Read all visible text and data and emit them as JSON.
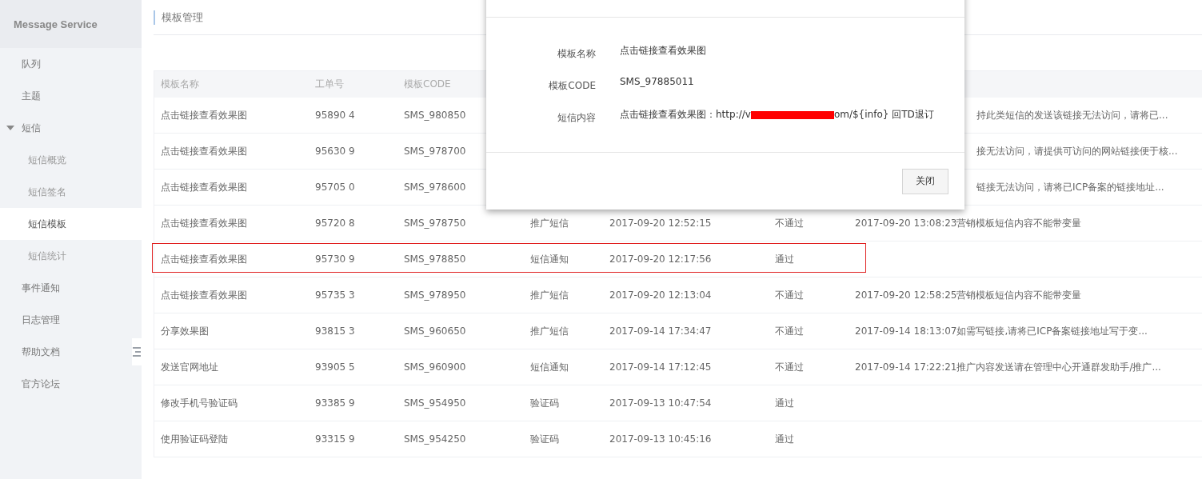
{
  "sidebar": {
    "title": "Message Service",
    "items": [
      {
        "label": "队列",
        "selected": false
      },
      {
        "label": "主题",
        "selected": false
      },
      {
        "label": "短信",
        "selected": false,
        "expanded": true,
        "children": [
          {
            "label": "短信概览",
            "selected": false
          },
          {
            "label": "短信签名",
            "selected": false
          },
          {
            "label": "短信模板",
            "selected": true
          },
          {
            "label": "短信统计",
            "selected": false
          }
        ]
      },
      {
        "label": "事件通知",
        "selected": false
      },
      {
        "label": "日志管理",
        "selected": false
      },
      {
        "label": "帮助文档",
        "selected": false
      },
      {
        "label": "官方论坛",
        "selected": false
      }
    ]
  },
  "page": {
    "title": "模板管理"
  },
  "table": {
    "columns": [
      "模板名称",
      "工单号",
      "模板CODE"
    ],
    "rows": [
      {
        "name": "点击链接查看效果图",
        "ticket": "95890 4",
        "code": "SMS_980850",
        "reason": "持此类短信的发送该链接无法访问，请将已...",
        "partly_hidden": true,
        "highlighted": false
      },
      {
        "name": "点击链接查看效果图",
        "ticket": "95630 9",
        "code": "SMS_978700",
        "reason": "接无法访问，请提供可访问的网站链接便于核...",
        "partly_hidden": true,
        "highlighted": false
      },
      {
        "name": "点击链接查看效果图",
        "ticket": "95705 0",
        "code": "SMS_978600",
        "reason": "链接无法访问，请将已ICP备案的链接地址...",
        "partly_hidden": true,
        "highlighted": false
      },
      {
        "name": "点击链接查看效果图",
        "ticket": "95720 8",
        "code": "SMS_978750",
        "type": "推广短信",
        "time": "2017-09-20 12:52:15",
        "status": "不通过",
        "reason": "2017-09-20 13:08:23营销模板短信内容不能带变量",
        "partly_hidden": false,
        "highlighted": false
      },
      {
        "name": "点击链接查看效果图",
        "ticket": "95730 9",
        "code": "SMS_978850",
        "type": "短信通知",
        "time": "2017-09-20 12:17:56",
        "status": "通过",
        "partly_hidden": false,
        "highlighted": true
      },
      {
        "name": "点击链接查看效果图",
        "ticket": "95735 3",
        "code": "SMS_978950",
        "type": "推广短信",
        "time": "2017-09-20 12:13:04",
        "status": "不通过",
        "reason": "2017-09-20 12:58:25营销模板短信内容不能带变量",
        "partly_hidden": false,
        "highlighted": false
      },
      {
        "name": "分享效果图",
        "ticket": "93815 3",
        "code": "SMS_960650",
        "type": "推广短信",
        "time": "2017-09-14 17:34:47",
        "status": "不通过",
        "reason": "2017-09-14 18:13:07如需写链接,请将已ICP备案链接地址写于变...",
        "partly_hidden": false,
        "highlighted": false
      },
      {
        "name": "发送官网地址",
        "ticket": "93905 5",
        "code": "SMS_960900",
        "type": "短信通知",
        "time": "2017-09-14 17:12:45",
        "status": "不通过",
        "reason": "2017-09-14 17:22:21推广内容发送请在管理中心开通群发助手/推广...",
        "partly_hidden": false,
        "highlighted": false
      },
      {
        "name": "修改手机号验证码",
        "ticket": "93385 9",
        "code": "SMS_954950",
        "type": "验证码",
        "time": "2017-09-13 10:47:54",
        "status": "通过",
        "partly_hidden": false,
        "highlighted": false
      },
      {
        "name": "使用验证码登陆",
        "ticket": "93315 9",
        "code": "SMS_954250",
        "type": "验证码",
        "time": "2017-09-13 10:45:16",
        "status": "通过",
        "partly_hidden": false,
        "highlighted": false
      }
    ]
  },
  "dialog": {
    "fields": [
      {
        "label": "模板名称",
        "segments": [
          {
            "kind": "text",
            "text": "点击链接查看效果图"
          }
        ]
      },
      {
        "label": "模板CODE",
        "segments": [
          {
            "kind": "text",
            "text": "SMS_97885011"
          }
        ]
      },
      {
        "label": "短信内容",
        "segments": [
          {
            "kind": "text",
            "text": "点击链接查看效果图：http://v"
          },
          {
            "kind": "redaction",
            "color": "#ff0000"
          },
          {
            "kind": "text",
            "text": "om/${info} 回TD退订"
          }
        ]
      }
    ],
    "button": "关闭"
  }
}
